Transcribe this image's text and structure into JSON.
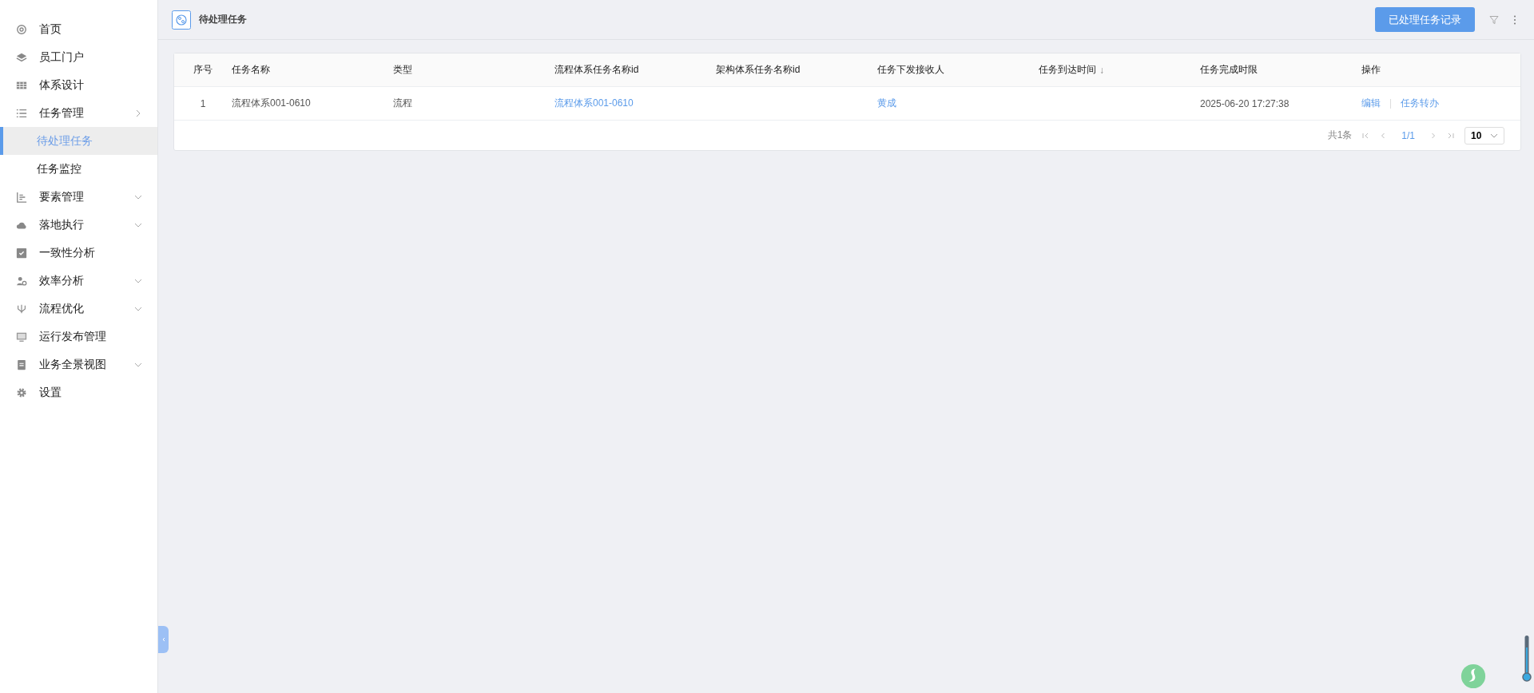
{
  "sidebar": {
    "items": [
      {
        "label": "首页",
        "kind": "link",
        "selected": false
      },
      {
        "label": "员工门户",
        "kind": "link",
        "selected": false
      },
      {
        "label": "体系设计",
        "kind": "link",
        "selected": false
      },
      {
        "label": "任务管理",
        "kind": "group",
        "expanded": true,
        "selected": false,
        "children": [
          {
            "label": "待处理任务",
            "selected": true
          },
          {
            "label": "任务监控",
            "selected": false
          }
        ]
      },
      {
        "label": "要素管理",
        "kind": "group",
        "expanded": false,
        "selected": false
      },
      {
        "label": "落地执行",
        "kind": "group",
        "expanded": false,
        "selected": false
      },
      {
        "label": "一致性分析",
        "kind": "link",
        "selected": false
      },
      {
        "label": "效率分析",
        "kind": "group",
        "expanded": false,
        "selected": false
      },
      {
        "label": "流程优化",
        "kind": "group",
        "expanded": false,
        "selected": false
      },
      {
        "label": "运行发布管理",
        "kind": "link",
        "selected": false
      },
      {
        "label": "业务全景视图",
        "kind": "group",
        "expanded": false,
        "selected": false
      },
      {
        "label": "设置",
        "kind": "link",
        "selected": false
      }
    ]
  },
  "header": {
    "title": "待处理任务",
    "button": "已处理任务记录"
  },
  "table": {
    "columns": [
      {
        "label": "序号"
      },
      {
        "label": "任务名称"
      },
      {
        "label": "类型"
      },
      {
        "label": "流程体系任务名称id"
      },
      {
        "label": "架构体系任务名称id"
      },
      {
        "label": "任务下发接收人"
      },
      {
        "label": "任务到达时间",
        "sort_arrow": "↓"
      },
      {
        "label": "任务完成时限"
      },
      {
        "label": "操作"
      }
    ],
    "rows": [
      {
        "cells": [
          {
            "text": "1",
            "kind": "plain"
          },
          {
            "text": "流程体系001-0610",
            "kind": "plain"
          },
          {
            "text": "流程",
            "kind": "plain"
          },
          {
            "text": "流程体系001-0610",
            "kind": "link"
          },
          {
            "kind": "empty"
          },
          {
            "text": "黄成",
            "kind": "link"
          },
          {
            "kind": "empty"
          },
          {
            "text": "2025-06-20 17:27:38",
            "kind": "plain"
          },
          {
            "kind": "actions",
            "actions": [
              "编辑",
              "任务转办"
            ]
          }
        ]
      }
    ]
  },
  "pagination": {
    "total": "共1条",
    "page": "1/1",
    "page_size": "10"
  }
}
